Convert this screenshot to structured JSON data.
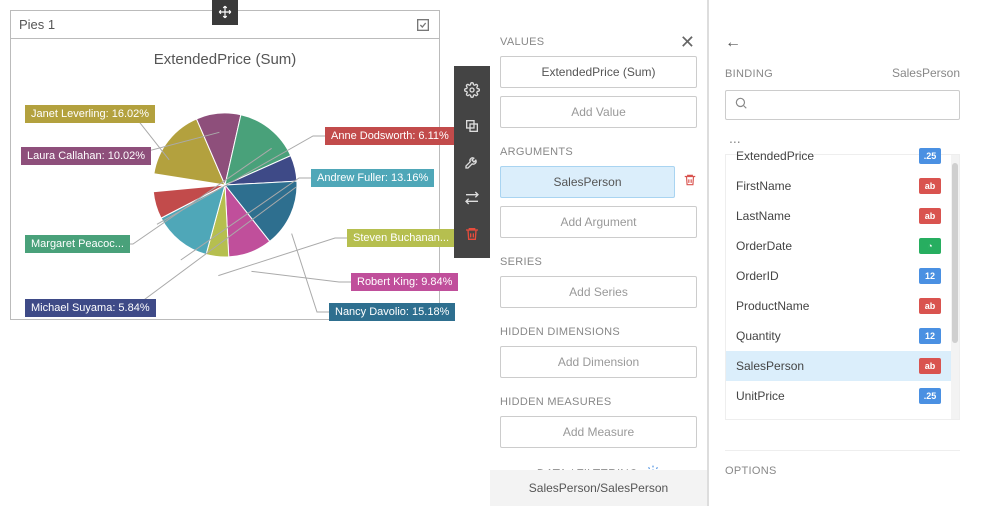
{
  "pie_widget": {
    "title": "Pies 1",
    "chart_title": "ExtendedPrice (Sum)"
  },
  "chart_data": {
    "type": "pie",
    "title": "ExtendedPrice (Sum)",
    "series_name": "SalesPerson",
    "value_field": "ExtendedPrice (Sum)",
    "slices": [
      {
        "label": "Janet Leverling",
        "value_pct": 16.02,
        "display": "Janet Leverling: 16.02%",
        "color": "#b3a13e"
      },
      {
        "label": "Laura Callahan",
        "value_pct": 10.02,
        "display": "Laura Callahan: 10.02%",
        "color": "#8e4f7b"
      },
      {
        "label": "Margaret Peacock",
        "value_pct": 14.77,
        "display": "Margaret Peacoc...",
        "color": "#49a17a"
      },
      {
        "label": "Michael Suyama",
        "value_pct": 5.84,
        "display": "Michael Suyama: 5.84%",
        "color": "#3e4a87"
      },
      {
        "label": "Nancy Davolio",
        "value_pct": 15.18,
        "display": "Nancy Davolio: 15.18%",
        "color": "#2e6f8f"
      },
      {
        "label": "Robert King",
        "value_pct": 9.84,
        "display": "Robert King: 9.84%",
        "color": "#c04f9b"
      },
      {
        "label": "Steven Buchanan",
        "value_pct": 5.06,
        "display": "Steven Buchanan...",
        "color": "#b6bf4f"
      },
      {
        "label": "Andrew Fuller",
        "value_pct": 13.16,
        "display": "Andrew Fuller: 13.16%",
        "color": "#4fa7b8"
      },
      {
        "label": "Anne Dodsworth",
        "value_pct": 6.11,
        "display": "Anne Dodsworth: 6.11%",
        "color": "#c24b4b"
      }
    ]
  },
  "config": {
    "sections": {
      "values": "VALUES",
      "arguments": "ARGUMENTS",
      "series": "SERIES",
      "hidden_dim": "HIDDEN DIMENSIONS",
      "hidden_meas": "HIDDEN MEASURES"
    },
    "values_field": "ExtendedPrice (Sum)",
    "add_value": "Add Value",
    "arguments_field": "SalesPerson",
    "add_argument": "Add Argument",
    "add_series": "Add Series",
    "add_dimension": "Add Dimension",
    "add_measure": "Add Measure",
    "data_filtering": "DATA / FILTERING",
    "breadcrumb": "SalesPerson/SalesPerson"
  },
  "binding": {
    "title": "BINDING",
    "value": "SalesPerson",
    "search_placeholder": "",
    "ellipsis": "...",
    "options": "OPTIONS",
    "fields": [
      {
        "name": "ExtendedPrice",
        "type": "decimal",
        "tag": ".25"
      },
      {
        "name": "FirstName",
        "type": "text",
        "tag": "ab"
      },
      {
        "name": "LastName",
        "type": "text",
        "tag": "ab"
      },
      {
        "name": "OrderDate",
        "type": "date",
        "tag": "◔"
      },
      {
        "name": "OrderID",
        "type": "int",
        "tag": "12"
      },
      {
        "name": "ProductName",
        "type": "text",
        "tag": "ab"
      },
      {
        "name": "Quantity",
        "type": "int",
        "tag": "12"
      },
      {
        "name": "SalesPerson",
        "type": "text",
        "tag": "ab",
        "selected": true
      },
      {
        "name": "UnitPrice",
        "type": "decimal",
        "tag": ".25"
      }
    ]
  }
}
